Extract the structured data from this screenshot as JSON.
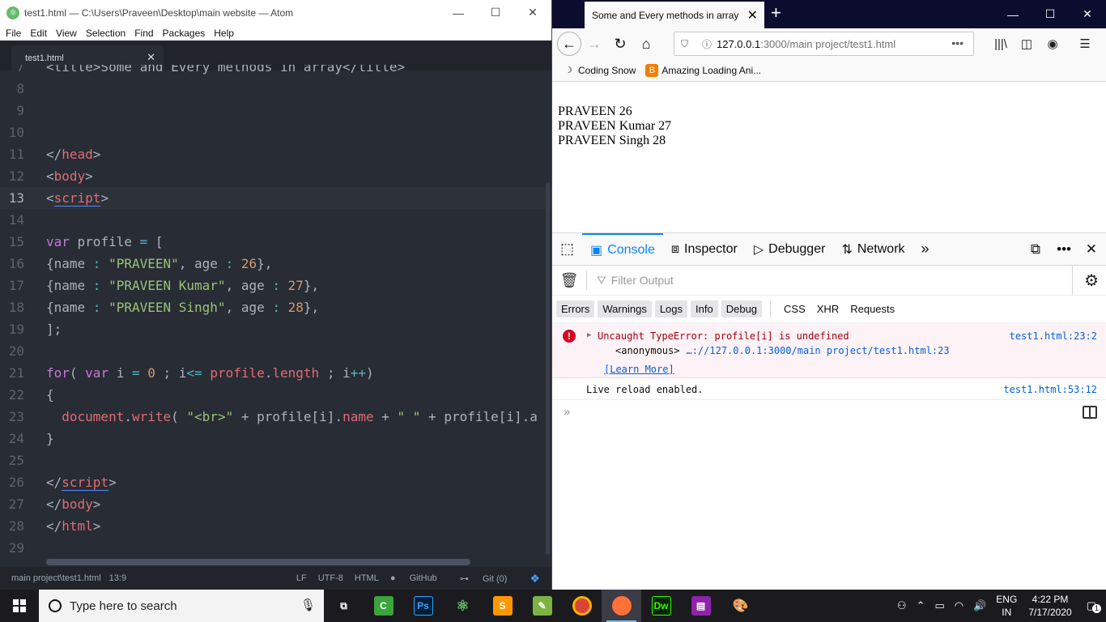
{
  "atom": {
    "title": "test1.html — C:\\Users\\Praveen\\Desktop\\main website — Atom",
    "menu": [
      "File",
      "Edit",
      "View",
      "Selection",
      "Find",
      "Packages",
      "Help"
    ],
    "tab_label": "test1.html",
    "status": {
      "path": "main project\\test1.html",
      "cursor": "13:9",
      "line_ending": "LF",
      "encoding": "UTF-8",
      "grammar": "HTML",
      "github": "GitHub",
      "git": "Git (0)"
    },
    "lines": {
      "n7": "7",
      "l7": "<title>Some and Every methods in array</title>",
      "n8": "8",
      "n9": "9",
      "n10": "10",
      "n11": "11",
      "l11a": "</",
      "l11b": "head",
      "l11c": ">",
      "n12": "12",
      "l12a": "<",
      "l12b": "body",
      "l12c": ">",
      "n13": "13",
      "l13a": "<",
      "l13b": "script",
      "l13c": ">",
      "n14": "14",
      "n15": "15",
      "l15a": "var",
      "l15b": " profile ",
      "l15c": "=",
      "l15d": " [",
      "n16": "16",
      "l16a": "{name ",
      "l16b": ":",
      "l16c": " \"PRAVEEN\"",
      "l16d": ", age ",
      "l16e": ":",
      "l16f": " 26",
      "l16g": "},",
      "n17": "17",
      "l17a": "{name ",
      "l17b": ":",
      "l17c": " \"PRAVEEN Kumar\"",
      "l17d": ", age ",
      "l17e": ":",
      "l17f": " 27",
      "l17g": "},",
      "n18": "18",
      "l18a": "{name ",
      "l18b": ":",
      "l18c": " \"PRAVEEN Singh\"",
      "l18d": ", age ",
      "l18e": ":",
      "l18f": " 28",
      "l18g": "},",
      "n19": "19",
      "l19": "];",
      "n20": "20",
      "n21": "21",
      "l21a": "for",
      "l21b": "( ",
      "l21c": "var",
      "l21d": " i ",
      "l21e": "=",
      "l21f": " 0",
      "l21g": " ; i",
      "l21h": "<=",
      "l21i": " profile",
      "l21j": ".",
      "l21k": "length",
      "l21l": " ; i",
      "l21m": "++",
      "l21n": ")",
      "n22": "22",
      "l22": "{",
      "n23": "23",
      "l23a": "  document",
      "l23b": ".",
      "l23c": "write",
      "l23d": "( ",
      "l23e": "\"<br>\"",
      "l23f": " + ",
      "l23g": "profile[i]",
      "l23h": ".",
      "l23i": "name",
      "l23j": " + ",
      "l23k": "\" \"",
      "l23l": " + ",
      "l23m": "profile[i]",
      "l23n": ".a",
      "n24": "24",
      "l24": "}",
      "n25": "25",
      "n26": "26",
      "l26a": "</",
      "l26b": "script",
      "l26c": ">",
      "n27": "27",
      "l27a": "</",
      "l27b": "body",
      "l27c": ">",
      "n28": "28",
      "l28a": "</",
      "l28b": "html",
      "l28c": ">",
      "n29": "29"
    }
  },
  "firefox": {
    "tab_title": "Some and Every methods in array",
    "url_host": "127.0.0.1",
    "url_rest": ":3000/main project/test1.html",
    "bookmarks": [
      "Coding Snow",
      "Amazing Loading Ani..."
    ],
    "page_lines": [
      "PRAVEEN 26",
      "PRAVEEN Kumar 27",
      "PRAVEEN Singh 28"
    ],
    "devtools": {
      "tabs": [
        "Console",
        "Inspector",
        "Debugger",
        "Network"
      ],
      "filter_placeholder": "Filter Output",
      "levels": [
        "Errors",
        "Warnings",
        "Logs",
        "Info",
        "Debug"
      ],
      "types": [
        "CSS",
        "XHR",
        "Requests"
      ],
      "error": {
        "text": "Uncaught TypeError: profile[i] is undefined",
        "location": "test1.html:23:2",
        "stack_fn": "<anonymous>",
        "stack_loc": "…://127.0.0.1:3000/main project/test1.html:23",
        "learn_more": "[Learn More]"
      },
      "log": {
        "text": "Live reload enabled.",
        "location": "test1.html:53:12"
      }
    }
  },
  "taskbar": {
    "search_placeholder": "Type here to search",
    "lang_top": "ENG",
    "lang_bottom": "IN",
    "time": "4:22 PM",
    "date": "7/17/2020",
    "notif_count": "1"
  }
}
